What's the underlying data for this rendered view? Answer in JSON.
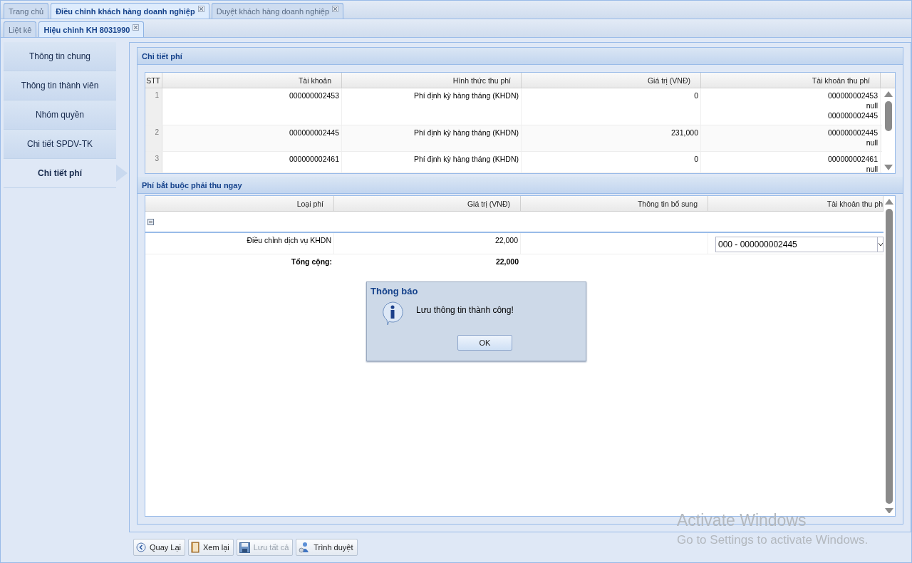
{
  "top_tabs": [
    {
      "label": "Trang chủ",
      "selected": false,
      "closable": false
    },
    {
      "label": "Điều chỉnh khách hàng doanh nghiệp",
      "selected": true,
      "closable": true
    },
    {
      "label": "Duyệt khách hàng doanh nghiệp",
      "selected": false,
      "closable": true
    }
  ],
  "sub_tabs": [
    {
      "label": "Liệt kê",
      "selected": false,
      "closable": false
    },
    {
      "label": "Hiệu chỉnh KH 8031990",
      "selected": true,
      "closable": true
    }
  ],
  "sidebar": {
    "items": [
      {
        "label": "Thông tin chung",
        "selected": false
      },
      {
        "label": "Thông tin thành viên",
        "selected": false
      },
      {
        "label": "Nhóm quyền",
        "selected": false
      },
      {
        "label": "Chi tiết SPDV-TK",
        "selected": false
      },
      {
        "label": "Chi tiết phí",
        "selected": true
      }
    ]
  },
  "fee_details": {
    "title": "Chi tiết phí",
    "columns": [
      "STT",
      "Tài khoản",
      "Hình thức thu phí",
      "Giá trị (VNĐ)",
      "Tài khoản thu phí"
    ],
    "rows": [
      {
        "stt": "1",
        "account": "000000002453",
        "fee_type": "Phí định kỳ hàng tháng (KHDN)",
        "value": "0",
        "fee_accounts": [
          "000000002453",
          "null",
          "000000002445"
        ]
      },
      {
        "stt": "2",
        "account": "000000002445",
        "fee_type": "Phí định kỳ hàng tháng (KHDN)",
        "value": "231,000",
        "fee_accounts": [
          "000000002445",
          "null"
        ]
      },
      {
        "stt": "3",
        "account": "000000002461",
        "fee_type": "Phí định kỳ hàng tháng (KHDN)",
        "value": "0",
        "fee_accounts": [
          "000000002461",
          "null"
        ]
      }
    ]
  },
  "mandatory_fees": {
    "title": "Phí bắt buộc phải thu ngay",
    "columns": [
      "Loại phí",
      "Giá trị (VNĐ)",
      "Thông tin bổ sung",
      "Tài khoản thu ph"
    ],
    "group": {
      "expanded": true
    },
    "rows": [
      {
        "fee_type": "Điều chỉnh dịch vụ KHDN",
        "value": "22,000",
        "account": "000 - 000000002445"
      }
    ],
    "total": {
      "label": "Tổng cộng:",
      "value": "22,000"
    }
  },
  "buttons": [
    {
      "kind": "back",
      "label": "Quay Lại",
      "disabled": false
    },
    {
      "kind": "review",
      "label": "Xem lại",
      "disabled": false
    },
    {
      "kind": "save",
      "label": "Lưu tất cả",
      "disabled": true
    },
    {
      "kind": "submit",
      "label": "Trình duyệt",
      "disabled": false
    }
  ],
  "dialog": {
    "title": "Thông báo",
    "message": "Lưu thông tin thành công!",
    "ok": "OK"
  },
  "os_notice": {
    "title": "Activate Windows",
    "subtitle": "Go to Settings to activate Windows."
  }
}
